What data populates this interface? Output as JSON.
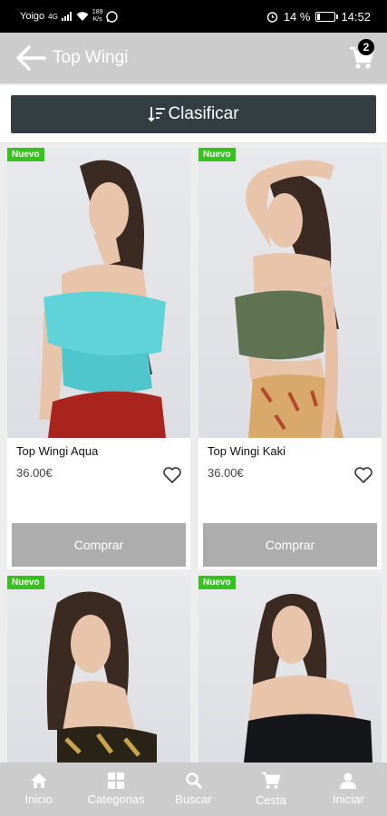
{
  "status_bar": {
    "carrier": "Yoigo",
    "network": "4G",
    "speed_value": "189",
    "speed_unit": "K/s",
    "alarm_icon": "alarm-icon",
    "battery_percent": "14 %",
    "battery_level": 0.14,
    "time": "14:52"
  },
  "app_bar": {
    "title": "Top Wingi",
    "cart_count": "2"
  },
  "sort": {
    "label": "Clasificar"
  },
  "products": [
    {
      "badge": "Nuevo",
      "name": "Top Wingi Aqua",
      "price": "36.00€",
      "buy_label": "Comprar",
      "top_color": "#5fd3d8",
      "bottom_color": "#a9241c"
    },
    {
      "badge": "Nuevo",
      "name": "Top Wingi Kaki",
      "price": "36.00€",
      "buy_label": "Comprar",
      "top_color": "#5f7252",
      "bottom_color": "#d9a86b"
    },
    {
      "badge": "Nuevo",
      "top_color": "#2a2418"
    },
    {
      "badge": "Nuevo",
      "top_color": "#15161a"
    }
  ],
  "bottom_nav": [
    {
      "label": "Inicio",
      "icon": "home-icon"
    },
    {
      "label": "Categorias",
      "icon": "grid-icon"
    },
    {
      "label": "Buscar",
      "icon": "search-icon"
    },
    {
      "label": "Cesta",
      "icon": "cart-icon"
    },
    {
      "label": "Iniciar",
      "icon": "user-icon"
    }
  ]
}
